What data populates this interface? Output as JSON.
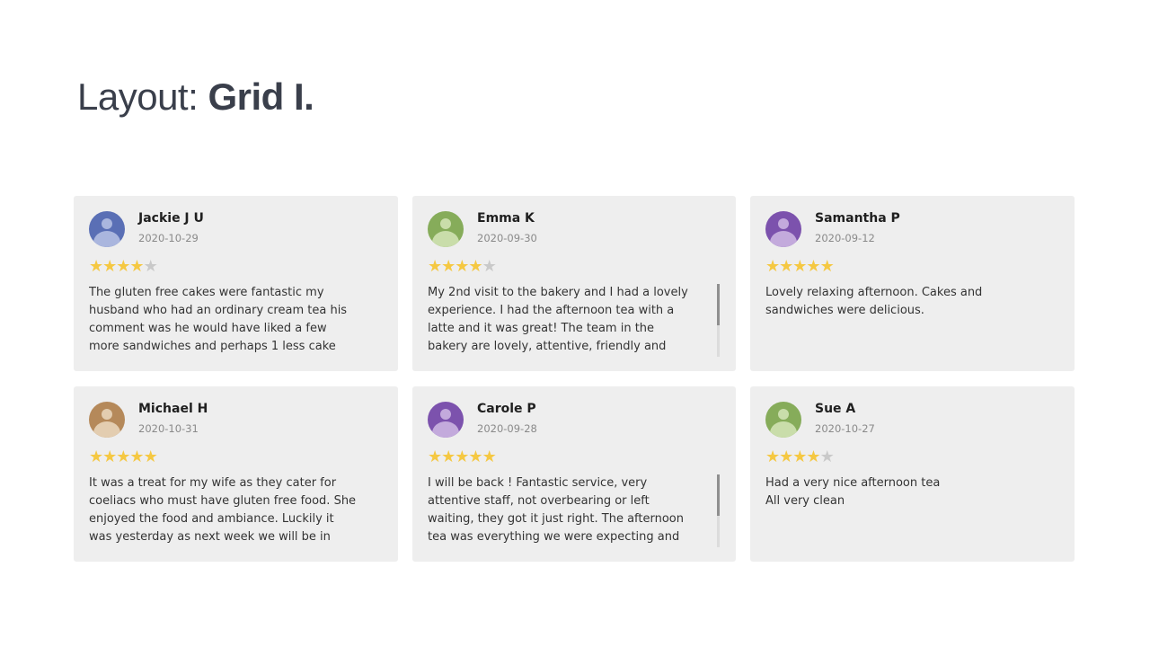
{
  "page": {
    "title_prefix": "Layout: ",
    "title_bold": "Grid I."
  },
  "reviews": [
    {
      "name": "Jackie J U",
      "date": "2020-10-29",
      "rating": 4,
      "avatar_color": "#5a6fb5",
      "avatar_person_color": "#aab6de",
      "text": "The gluten free cakes were fantastic my husband who had an ordinary cream tea his comment was he would have liked a few more sandwiches and perhaps 1 less cake",
      "scrollable": false
    },
    {
      "name": "Emma K",
      "date": "2020-09-30",
      "rating": 4,
      "avatar_color": "#86ac5a",
      "avatar_person_color": "#c9ddaa",
      "text": "My 2nd visit to the bakery and I had a lovely experience. I had the afternoon tea with a latte and it was great! The team in the bakery are lovely, attentive, friendly and professional at",
      "scrollable": true
    },
    {
      "name": "Samantha P",
      "date": "2020-09-12",
      "rating": 5,
      "avatar_color": "#7c52ad",
      "avatar_person_color": "#c3aadc",
      "text": "Lovely relaxing afternoon. Cakes and sandwiches were delicious.",
      "scrollable": false
    },
    {
      "name": "Michael H",
      "date": "2020-10-31",
      "rating": 5,
      "avatar_color": "#b5895a",
      "avatar_person_color": "#e3cdb0",
      "text": "It was a treat for my wife as they cater for coeliacs who must have gluten free food. She enjoyed the food and ambiance. Luckily it was yesterday as next week we will be in lockdown",
      "scrollable": false
    },
    {
      "name": "Carole P",
      "date": "2020-09-28",
      "rating": 5,
      "avatar_color": "#7c52ad",
      "avatar_person_color": "#c3aadc",
      "text": "I will be back ! Fantastic service, very attentive staff, not overbearing or left waiting, they got it just right. The afternoon tea was everything we were expecting and more, my email to Brigits ,",
      "scrollable": true
    },
    {
      "name": "Sue A",
      "date": "2020-10-27",
      "rating": 4,
      "avatar_color": "#86ac5a",
      "avatar_person_color": "#c9ddaa",
      "text": "Had a very nice afternoon tea\nAll very clean",
      "scrollable": false
    }
  ]
}
